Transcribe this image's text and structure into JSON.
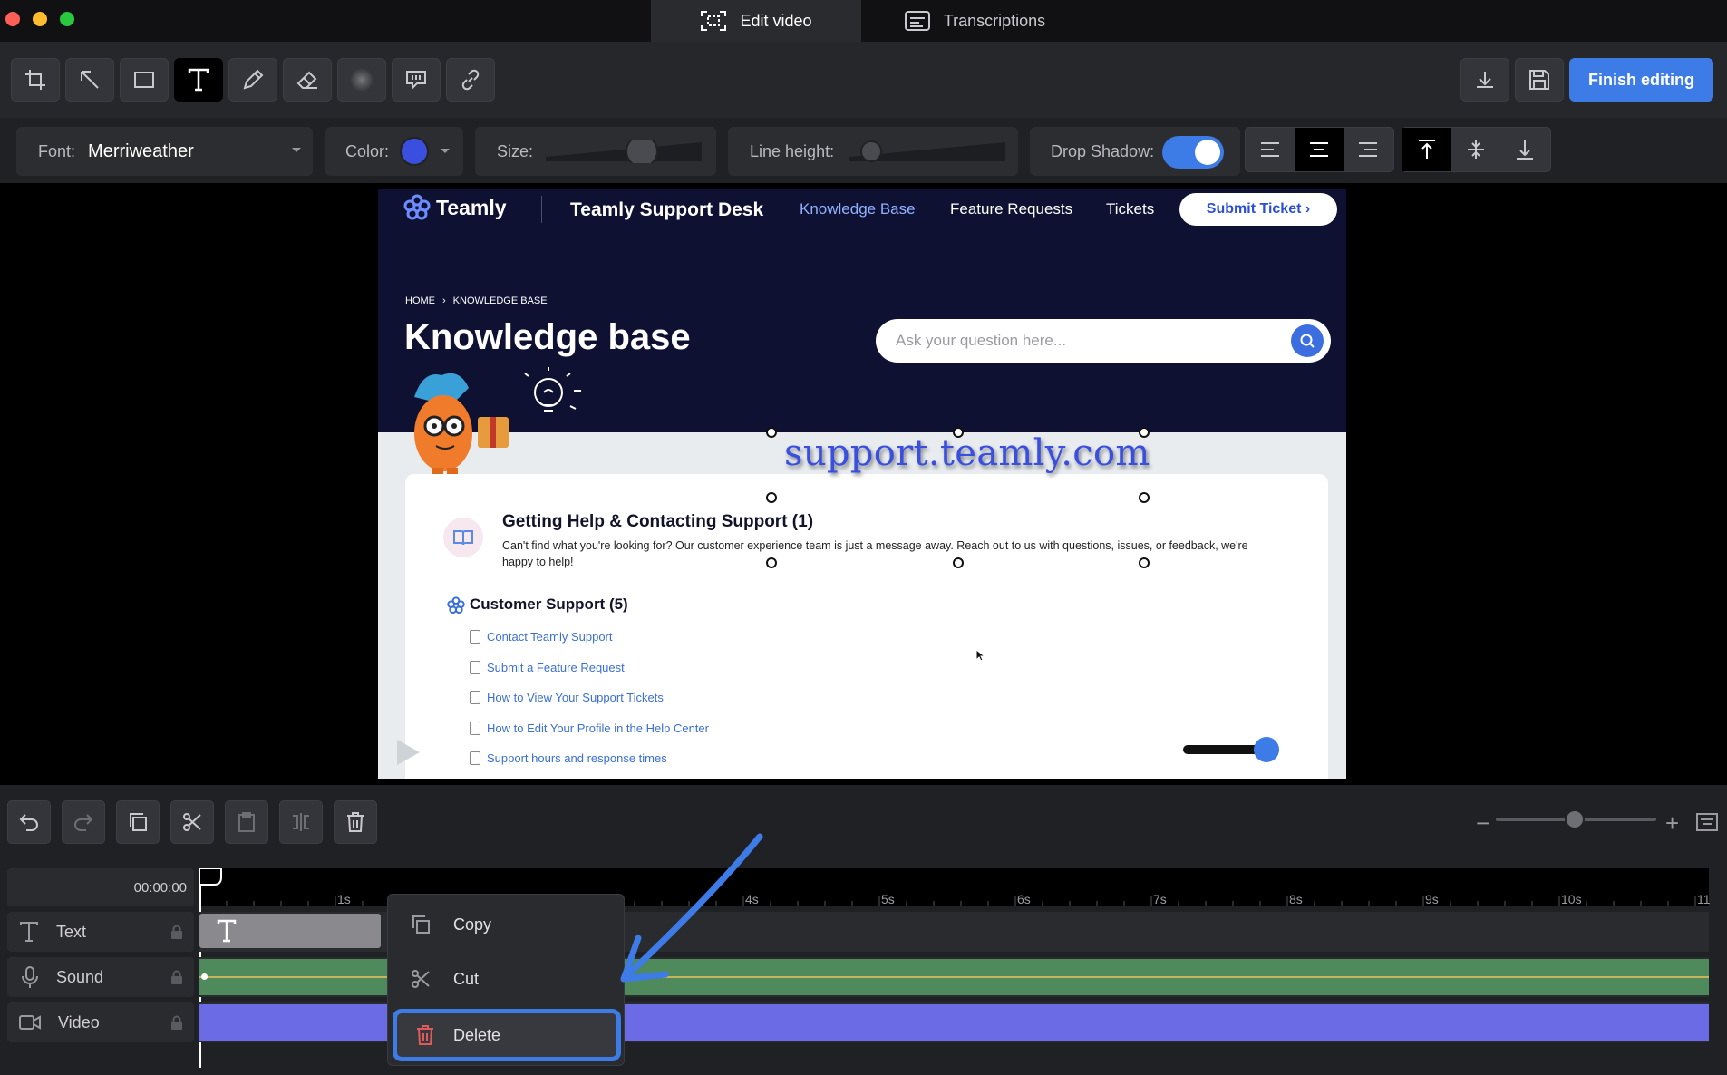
{
  "window": {
    "tabs": [
      {
        "label": "Edit video",
        "icon": "screen-capture-icon",
        "active": true
      },
      {
        "label": "Transcriptions",
        "icon": "subtitles-icon",
        "active": false
      }
    ]
  },
  "toolbar": {
    "tools": [
      "crop-icon",
      "arrow-icon",
      "rectangle-icon",
      "text-icon",
      "pencil-icon",
      "eraser-icon",
      "blur-icon",
      "callout-icon",
      "link-icon"
    ],
    "active_tool": "text-icon",
    "finish_label": "Finish editing"
  },
  "props": {
    "font_label": "Font:",
    "font_value": "Merriweather",
    "color_label": "Color:",
    "color_value": "#3a4fe0",
    "size_label": "Size:",
    "line_height_label": "Line height:",
    "shadow_label": "Drop Shadow:",
    "shadow_on": true
  },
  "video": {
    "brand": "Teamly",
    "desk_title": "Teamly Support Desk",
    "nav": [
      "Knowledge Base",
      "Feature Requests",
      "Tickets"
    ],
    "submit": "Submit Ticket ›",
    "breadcrumb_home": "HOME",
    "breadcrumb_sep": "›",
    "breadcrumb_current": "KNOWLEDGE BASE",
    "page_title": "Knowledge base",
    "search_placeholder": "Ask your question here...",
    "overlay_text": "support.teamly.com",
    "section1_title": "Getting Help & Contacting Support (1)",
    "section1_desc": "Can't find what you're looking for? Our customer experience team is just a message away. Reach out to us with questions, issues, or feedback, we're happy to help!",
    "section2_title": "Customer Support (5)",
    "articles": [
      "Contact Teamly Support",
      "Submit a Feature Request",
      "How to View Your Support Tickets",
      "How to Edit Your Profile in the Help Center",
      "Support hours and response times"
    ]
  },
  "timeline": {
    "timecode": "00:00:00",
    "ticks": [
      "1s",
      "4s",
      "5s",
      "6s",
      "7s",
      "8s",
      "9s",
      "10s",
      "11"
    ],
    "tracks": [
      {
        "label": "Text",
        "icon": "text-icon"
      },
      {
        "label": "Sound",
        "icon": "microphone-icon"
      },
      {
        "label": "Video",
        "icon": "video-camera-icon"
      }
    ]
  },
  "context_menu": {
    "copy": "Copy",
    "cut": "Cut",
    "delete": "Delete"
  },
  "colors": {
    "accent": "#3d7be6",
    "video_track": "#6b6be6",
    "sound_track": "#4f8a5c",
    "text_track": "#8a8a8e",
    "delete_icon": "#e05a5a"
  }
}
